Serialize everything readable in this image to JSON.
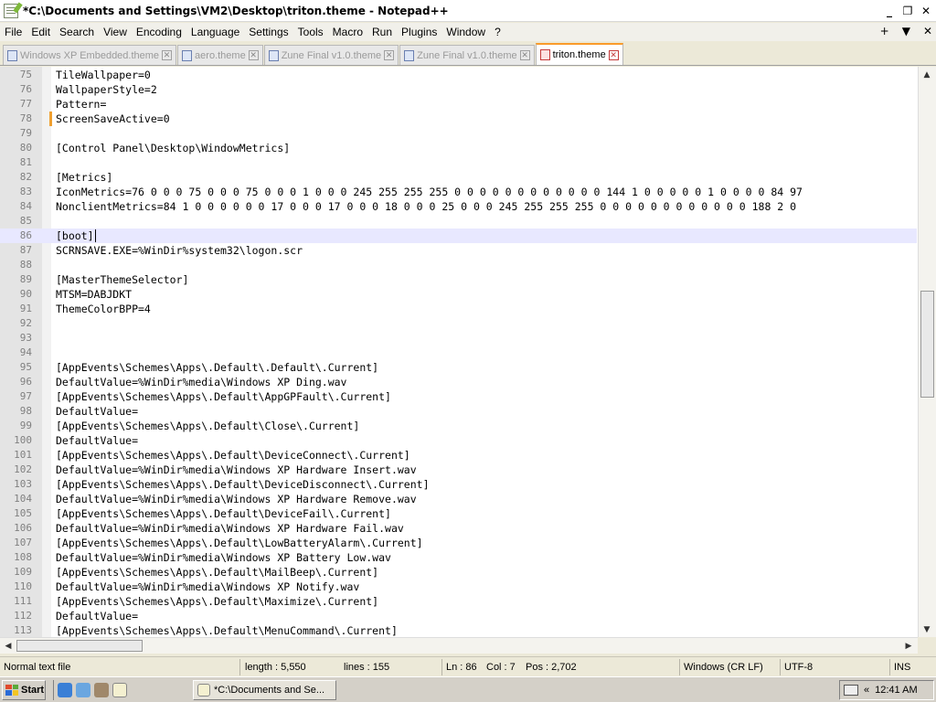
{
  "window": {
    "title": "*C:\\Documents and Settings\\VM2\\Desktop\\triton.theme - Notepad++",
    "buttons": {
      "minimize": "_",
      "restore": "❐",
      "close": "✕"
    }
  },
  "menubar": {
    "items": [
      "File",
      "Edit",
      "Search",
      "View",
      "Encoding",
      "Language",
      "Settings",
      "Tools",
      "Macro",
      "Run",
      "Plugins",
      "Window",
      "?"
    ],
    "right": {
      "plus": "+",
      "down": "▼",
      "close": "✕"
    }
  },
  "tabs": [
    {
      "label": "Windows XP Embedded.theme",
      "active": false
    },
    {
      "label": "aero.theme",
      "active": false
    },
    {
      "label": "Zune Final v1.0.theme",
      "active": false
    },
    {
      "label": "Zune Final v1.0.theme",
      "active": false
    },
    {
      "label": "triton.theme",
      "active": true
    }
  ],
  "editor": {
    "current_line": 86,
    "changed_lines": [
      78
    ],
    "lines": [
      {
        "n": "75",
        "text": "TileWallpaper=0"
      },
      {
        "n": "76",
        "text": "WallpaperStyle=2"
      },
      {
        "n": "77",
        "text": "Pattern="
      },
      {
        "n": "78",
        "text": "ScreenSaveActive=0"
      },
      {
        "n": "79",
        "text": ""
      },
      {
        "n": "80",
        "text": "[Control Panel\\Desktop\\WindowMetrics]"
      },
      {
        "n": "81",
        "text": ""
      },
      {
        "n": "82",
        "text": "[Metrics]"
      },
      {
        "n": "83",
        "text": "IconMetrics=76 0 0 0 75 0 0 0 75 0 0 0 1 0 0 0 245 255 255 255 0 0 0 0 0 0 0 0 0 0 0 0 144 1 0 0 0 0 0 1 0 0 0 0 84 97"
      },
      {
        "n": "84",
        "text": "NonclientMetrics=84 1 0 0 0 0 0 0 17 0 0 0 17 0 0 0 18 0 0 0 25 0 0 0 245 255 255 255 0 0 0 0 0 0 0 0 0 0 0 0 188 2 0"
      },
      {
        "n": "85",
        "text": ""
      },
      {
        "n": "86",
        "text": "[boot]"
      },
      {
        "n": "87",
        "text": "SCRNSAVE.EXE=%WinDir%system32\\logon.scr"
      },
      {
        "n": "88",
        "text": ""
      },
      {
        "n": "89",
        "text": "[MasterThemeSelector]"
      },
      {
        "n": "90",
        "text": "MTSM=DABJDKT"
      },
      {
        "n": "91",
        "text": "ThemeColorBPP=4"
      },
      {
        "n": "92",
        "text": ""
      },
      {
        "n": "93",
        "text": ""
      },
      {
        "n": "94",
        "text": ""
      },
      {
        "n": "95",
        "text": "[AppEvents\\Schemes\\Apps\\.Default\\.Default\\.Current]"
      },
      {
        "n": "96",
        "text": "DefaultValue=%WinDir%media\\Windows XP Ding.wav"
      },
      {
        "n": "97",
        "text": "[AppEvents\\Schemes\\Apps\\.Default\\AppGPFault\\.Current]"
      },
      {
        "n": "98",
        "text": "DefaultValue="
      },
      {
        "n": "99",
        "text": "[AppEvents\\Schemes\\Apps\\.Default\\Close\\.Current]"
      },
      {
        "n": "100",
        "text": "DefaultValue="
      },
      {
        "n": "101",
        "text": "[AppEvents\\Schemes\\Apps\\.Default\\DeviceConnect\\.Current]"
      },
      {
        "n": "102",
        "text": "DefaultValue=%WinDir%media\\Windows XP Hardware Insert.wav"
      },
      {
        "n": "103",
        "text": "[AppEvents\\Schemes\\Apps\\.Default\\DeviceDisconnect\\.Current]"
      },
      {
        "n": "104",
        "text": "DefaultValue=%WinDir%media\\Windows XP Hardware Remove.wav"
      },
      {
        "n": "105",
        "text": "[AppEvents\\Schemes\\Apps\\.Default\\DeviceFail\\.Current]"
      },
      {
        "n": "106",
        "text": "DefaultValue=%WinDir%media\\Windows XP Hardware Fail.wav"
      },
      {
        "n": "107",
        "text": "[AppEvents\\Schemes\\Apps\\.Default\\LowBatteryAlarm\\.Current]"
      },
      {
        "n": "108",
        "text": "DefaultValue=%WinDir%media\\Windows XP Battery Low.wav"
      },
      {
        "n": "109",
        "text": "[AppEvents\\Schemes\\Apps\\.Default\\MailBeep\\.Current]"
      },
      {
        "n": "110",
        "text": "DefaultValue=%WinDir%media\\Windows XP Notify.wav"
      },
      {
        "n": "111",
        "text": "[AppEvents\\Schemes\\Apps\\.Default\\Maximize\\.Current]"
      },
      {
        "n": "112",
        "text": "DefaultValue="
      },
      {
        "n": "113",
        "text": "[AppEvents\\Schemes\\Apps\\.Default\\MenuCommand\\.Current]"
      }
    ]
  },
  "statusbar": {
    "file_type": "Normal text file",
    "length": "length : 5,550",
    "lines": "lines : 155",
    "ln": "Ln : 86",
    "col": "Col : 7",
    "pos": "Pos : 2,702",
    "eol": "Windows (CR LF)",
    "encoding": "UTF-8",
    "mode": "INS"
  },
  "taskbar": {
    "start_label": "Start",
    "task_label": "*C:\\Documents and Se...",
    "clock": "12:41 AM",
    "tray_arrow": "«"
  },
  "colors": {
    "tab_active_accent": "#fa9b2a",
    "current_line_bg": "#e8e8ff",
    "change_marker": "#f0a030"
  }
}
